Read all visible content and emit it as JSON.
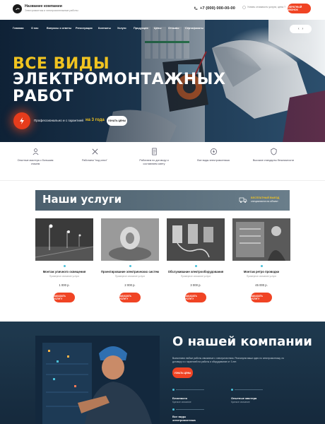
{
  "header": {
    "brand_name": "Название компании",
    "brand_sub": "Электромонтаж и электромонтажные работы",
    "phone": "+7 (000) 000-00-00",
    "call_info": "Узнать стоимость услуги, цена ?",
    "cta": "ОБРАТНЫЙ ЗВОНОК"
  },
  "nav": {
    "items": [
      "Главная",
      "О нас",
      "Вопросы и ответы",
      "Регистрация",
      "Контакты",
      "Услуги",
      "Продукция",
      "Цены",
      "Отзывы",
      "Сертификаты"
    ],
    "arrows": [
      "‹",
      "›"
    ]
  },
  "hero": {
    "line1": "ВСЕ ВИДЫ",
    "line2": "ЭЛЕКТРОМОНТАЖНЫХ",
    "line3": "РАБОТ",
    "badge_text": "Профессионально и с гарантией",
    "badge_years": "на 3 года",
    "cta": "УЗНАТЬ ЦЕНЫ"
  },
  "features": [
    {
      "icon": "worker-icon",
      "label": "Опытные мастера с большим стажем"
    },
    {
      "icon": "tools-icon",
      "label": "Работаем \"под ключ\""
    },
    {
      "icon": "document-icon",
      "label": "Работаем по договору и составляем смету"
    },
    {
      "icon": "lightning-icon",
      "label": "Все виды электромонтажа"
    },
    {
      "icon": "shield-icon",
      "label": "Высокие стандарты безопасности"
    }
  ],
  "services": {
    "title": "Наши услуги",
    "delivery_label": "БЕСПЛАТНЫЙ ВЫЕЗД",
    "delivery_sub": "специалиста на объект",
    "cards": [
      {
        "title": "Монтаж уличного освещения",
        "sub": "Примерное описание услуги",
        "price": "1 000 р.",
        "button": "ЗАКАЗАТЬ УСЛУГУ"
      },
      {
        "title": "Проектирование электрических систем",
        "sub": "Примерное описание услуги",
        "price": "2 000 р.",
        "button": "ЗАКАЗАТЬ УСЛУГУ"
      },
      {
        "title": "Обслуживание электрооборудования",
        "sub": "Примерное описание услуги",
        "price": "3 000 р.",
        "button": "ЗАКАЗАТЬ УСЛУГУ"
      },
      {
        "title": "Монтаж ретро проводки",
        "sub": "Примерное описание услуги",
        "price": "45 000 р.",
        "button": "ЗАКАЗАТЬ УСЛУГУ"
      }
    ]
  },
  "about": {
    "title": "О нашей компании",
    "text": "Выполняем любые работы связанные с электричеством. Реализуем ваши идеи по электромонтажу, по договору и с гарантией на работы и оборудование от 3 лет.",
    "button": "УЗНАТЬ ЦЕНЫ",
    "stats": [
      {
        "title": "Безопасно",
        "sub": "Краткое описание"
      },
      {
        "title": "Опытные мастера",
        "sub": "Краткое описание"
      },
      {
        "title": "Все виды электромонтажа",
        "sub": ""
      }
    ]
  },
  "colors": {
    "accent": "#f04424",
    "yellow": "#f0c320",
    "dark": "#1f3a4f",
    "dot": "#4bc0d9"
  }
}
